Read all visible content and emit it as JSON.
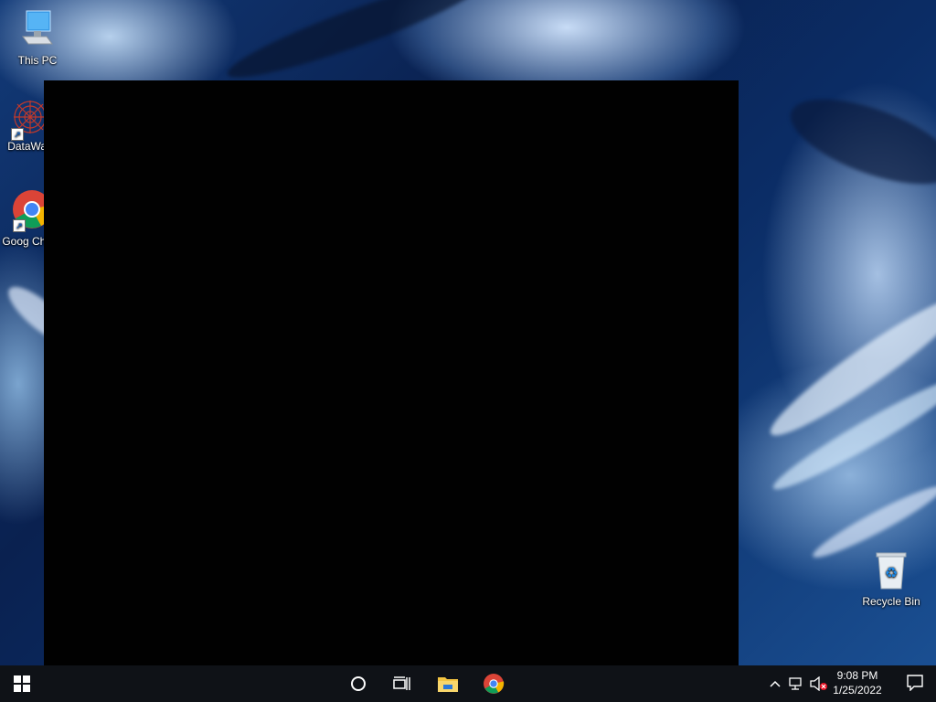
{
  "desktop": {
    "icons": [
      {
        "label": "This PC"
      },
      {
        "label": "DataWag"
      },
      {
        "label": "Goog Chron"
      },
      {
        "label": "Recycle Bin"
      }
    ]
  },
  "taskbar": {
    "clock": {
      "time": "9:08 PM",
      "date": "1/25/2022"
    }
  },
  "icons": [
    "windows-logo-icon",
    "cortana-circle-icon",
    "task-view-icon",
    "file-explorer-icon",
    "chrome-icon",
    "chevron-up-icon",
    "network-icon",
    "volume-muted-icon",
    "notification-icon"
  ],
  "colors": {
    "taskbar": "#0f1217",
    "accent": "#1a73e8"
  }
}
